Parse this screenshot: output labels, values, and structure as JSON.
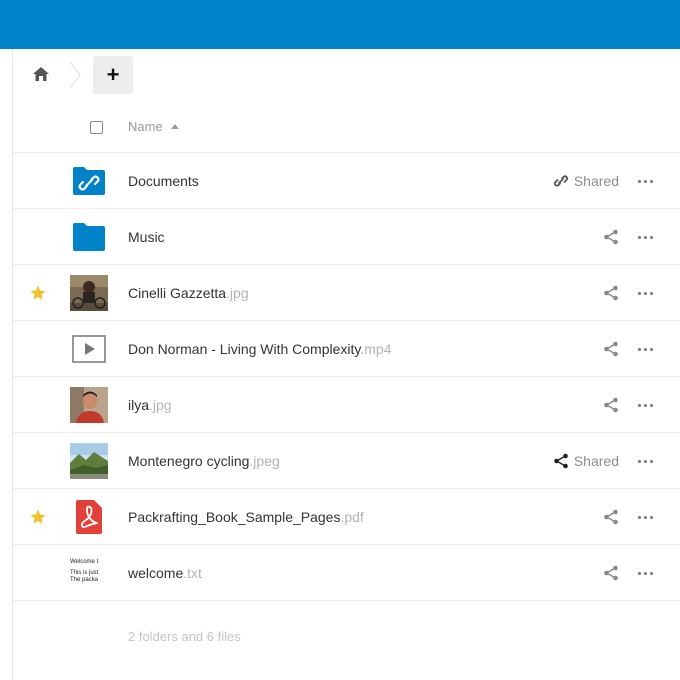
{
  "new_button_label": "+",
  "header": {
    "name_label": "Name"
  },
  "files": [
    {
      "name": "Documents",
      "ext": "",
      "starred": false,
      "thumb": "shared-folder-icon",
      "share_icon": "link-icon",
      "share_label": "Shared"
    },
    {
      "name": "Music",
      "ext": "",
      "starred": false,
      "thumb": "folder-icon",
      "share_icon": "share-icon",
      "share_label": ""
    },
    {
      "name": "Cinelli Gazzetta",
      "ext": ".jpg",
      "starred": true,
      "thumb": "photo-thumbnail",
      "share_icon": "share-icon",
      "share_label": ""
    },
    {
      "name": "Don Norman - Living With Complexity",
      "ext": ".mp4",
      "starred": false,
      "thumb": "video-icon",
      "share_icon": "share-icon",
      "share_label": ""
    },
    {
      "name": "ilya",
      "ext": ".jpg",
      "starred": false,
      "thumb": "portrait-thumbnail",
      "share_icon": "share-icon",
      "share_label": ""
    },
    {
      "name": "Montenegro cycling",
      "ext": ".jpeg",
      "starred": false,
      "thumb": "landscape-thumbnail",
      "share_icon": "share-icon-dark",
      "share_label": "Shared"
    },
    {
      "name": "Packrafting_Book_Sample_Pages",
      "ext": ".pdf",
      "starred": true,
      "thumb": "pdf-icon",
      "share_icon": "share-icon",
      "share_label": ""
    },
    {
      "name": "welcome",
      "ext": ".txt",
      "starred": false,
      "thumb": "text-thumbnail",
      "share_icon": "share-icon",
      "share_label": ""
    }
  ],
  "text_preview": {
    "line1": "Welcome t",
    "line2": "This is just",
    "line3": "The packa"
  },
  "summary": "2 folders and 6 files",
  "colors": {
    "topbar": "#0082c9",
    "folder": "#0082c9",
    "star": "#f2c230",
    "pdf": "#e2403a"
  }
}
